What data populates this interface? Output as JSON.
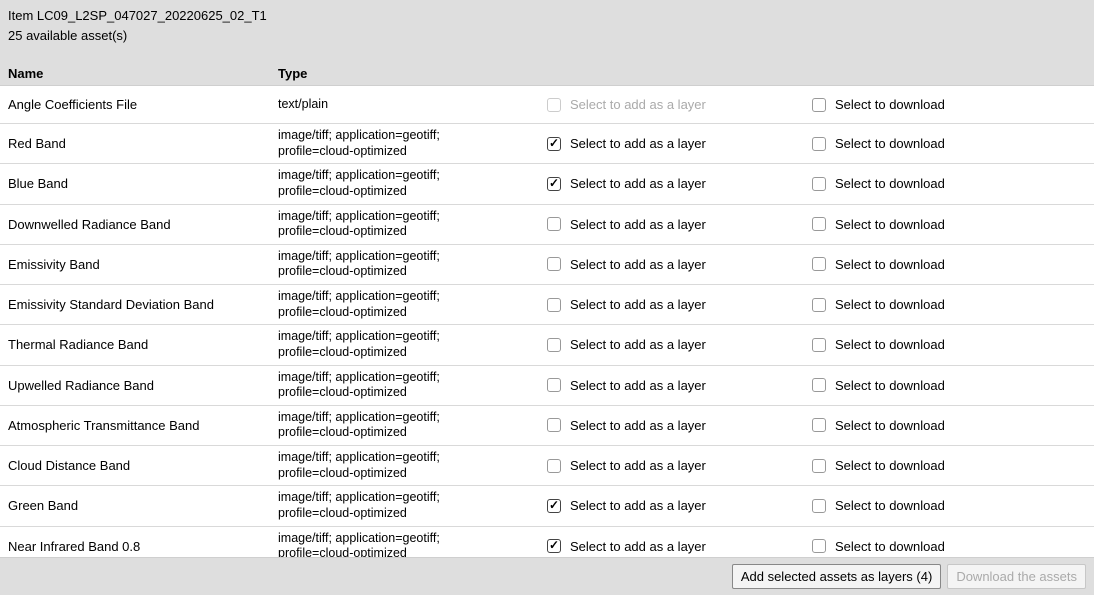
{
  "header": {
    "title": "Item LC09_L2SP_047027_20220625_02_T1",
    "subtitle": "25 available asset(s)"
  },
  "columns": {
    "name": "Name",
    "type": "Type"
  },
  "labels": {
    "add_layer": "Select to add as a layer",
    "download": "Select to download"
  },
  "footer": {
    "add_button": "Add selected assets as layers (4)",
    "download_button": "Download the assets"
  },
  "rows": [
    {
      "name": "Angle Coefficients File",
      "type": "text/plain",
      "layer_checked": false,
      "layer_disabled": true,
      "dl_checked": false
    },
    {
      "name": "Red Band",
      "type": "image/tiff; application=geotiff; profile=cloud-optimized",
      "layer_checked": true,
      "layer_disabled": false,
      "dl_checked": false
    },
    {
      "name": "Blue Band",
      "type": "image/tiff; application=geotiff; profile=cloud-optimized",
      "layer_checked": true,
      "layer_disabled": false,
      "dl_checked": false
    },
    {
      "name": "Downwelled Radiance Band",
      "type": "image/tiff; application=geotiff; profile=cloud-optimized",
      "layer_checked": false,
      "layer_disabled": false,
      "dl_checked": false
    },
    {
      "name": "Emissivity Band",
      "type": "image/tiff; application=geotiff; profile=cloud-optimized",
      "layer_checked": false,
      "layer_disabled": false,
      "dl_checked": false
    },
    {
      "name": "Emissivity Standard Deviation Band",
      "type": "image/tiff; application=geotiff; profile=cloud-optimized",
      "layer_checked": false,
      "layer_disabled": false,
      "dl_checked": false
    },
    {
      "name": "Thermal Radiance Band",
      "type": "image/tiff; application=geotiff; profile=cloud-optimized",
      "layer_checked": false,
      "layer_disabled": false,
      "dl_checked": false
    },
    {
      "name": "Upwelled Radiance Band",
      "type": "image/tiff; application=geotiff; profile=cloud-optimized",
      "layer_checked": false,
      "layer_disabled": false,
      "dl_checked": false
    },
    {
      "name": "Atmospheric Transmittance Band",
      "type": "image/tiff; application=geotiff; profile=cloud-optimized",
      "layer_checked": false,
      "layer_disabled": false,
      "dl_checked": false
    },
    {
      "name": "Cloud Distance Band",
      "type": "image/tiff; application=geotiff; profile=cloud-optimized",
      "layer_checked": false,
      "layer_disabled": false,
      "dl_checked": false
    },
    {
      "name": "Green Band",
      "type": "image/tiff; application=geotiff; profile=cloud-optimized",
      "layer_checked": true,
      "layer_disabled": false,
      "dl_checked": false
    },
    {
      "name": "Near Infrared Band 0.8",
      "type": "image/tiff; application=geotiff; profile=cloud-optimized",
      "layer_checked": true,
      "layer_disabled": false,
      "dl_checked": false
    }
  ]
}
